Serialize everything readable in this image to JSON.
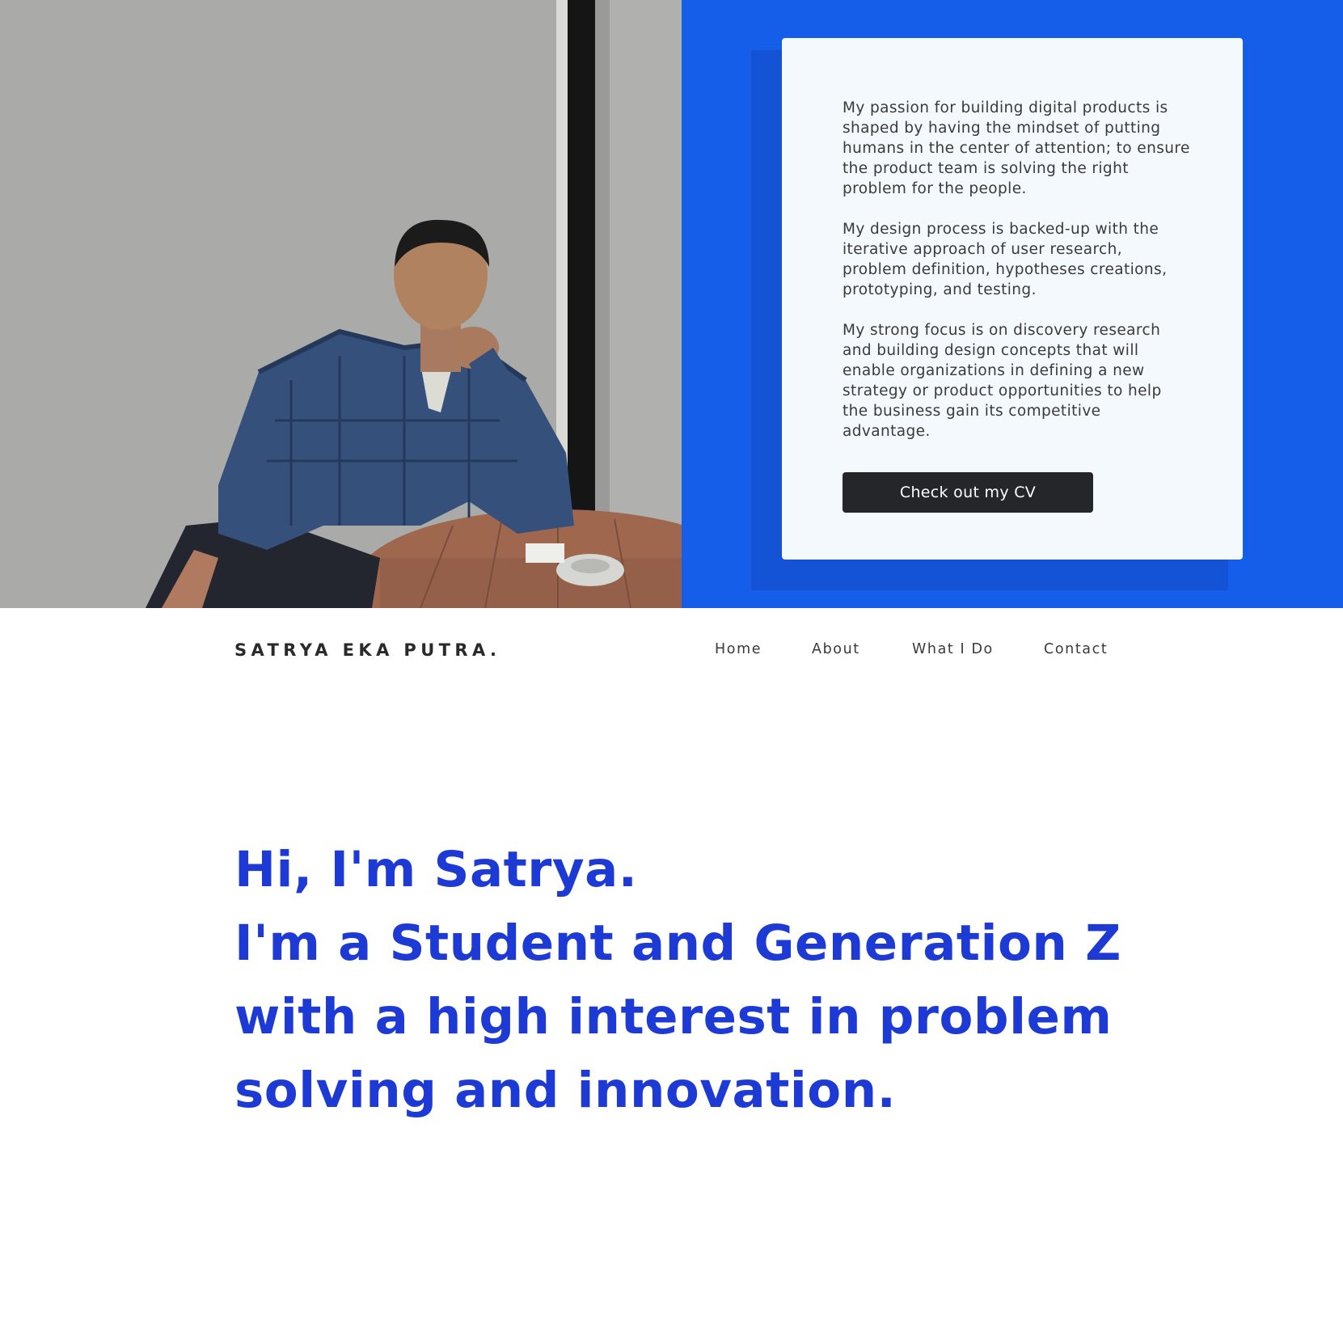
{
  "about_card": {
    "paragraphs": [
      "My passion for building digital products is shaped by having the mindset of putting humans in the center of attention; to ensure the product team is solving the right problem for the people.",
      "My design process is backed-up with the iterative approach of user research, problem definition, hypotheses creations, prototyping, and testing.",
      "My strong focus is on discovery research and building design concepts that will enable organizations in defining a new strategy or product opportunities to help the business gain its competitive advantage."
    ],
    "cv_button_label": "Check out my CV"
  },
  "header": {
    "brand": "SATRYA EKA PUTRA."
  },
  "nav": {
    "items": [
      {
        "label": "Home"
      },
      {
        "label": "About"
      },
      {
        "label": "What I Do"
      },
      {
        "label": "Contact"
      }
    ]
  },
  "hero": {
    "headline_lines": [
      "Hi, I'm Satrya.",
      "I'm a Student and Generation Z",
      "with a high interest in problem",
      "solving and innovation."
    ]
  },
  "colors": {
    "panel_blue": "#155eea",
    "headline_blue": "#1d3bd4",
    "button_dark": "#24262a",
    "card_bg": "#f3f9fd"
  }
}
